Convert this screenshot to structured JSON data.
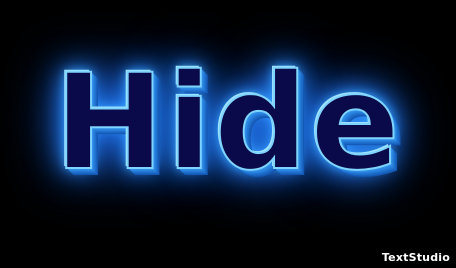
{
  "artwork": {
    "word": "Hide",
    "style": "neon glow 3D text",
    "colors": {
      "background": "#000000",
      "text_fill": "#0a0a4a",
      "glow": "#2f8fff",
      "edge": "#7fd4ff"
    }
  },
  "watermark": {
    "text": "TextStudio"
  }
}
